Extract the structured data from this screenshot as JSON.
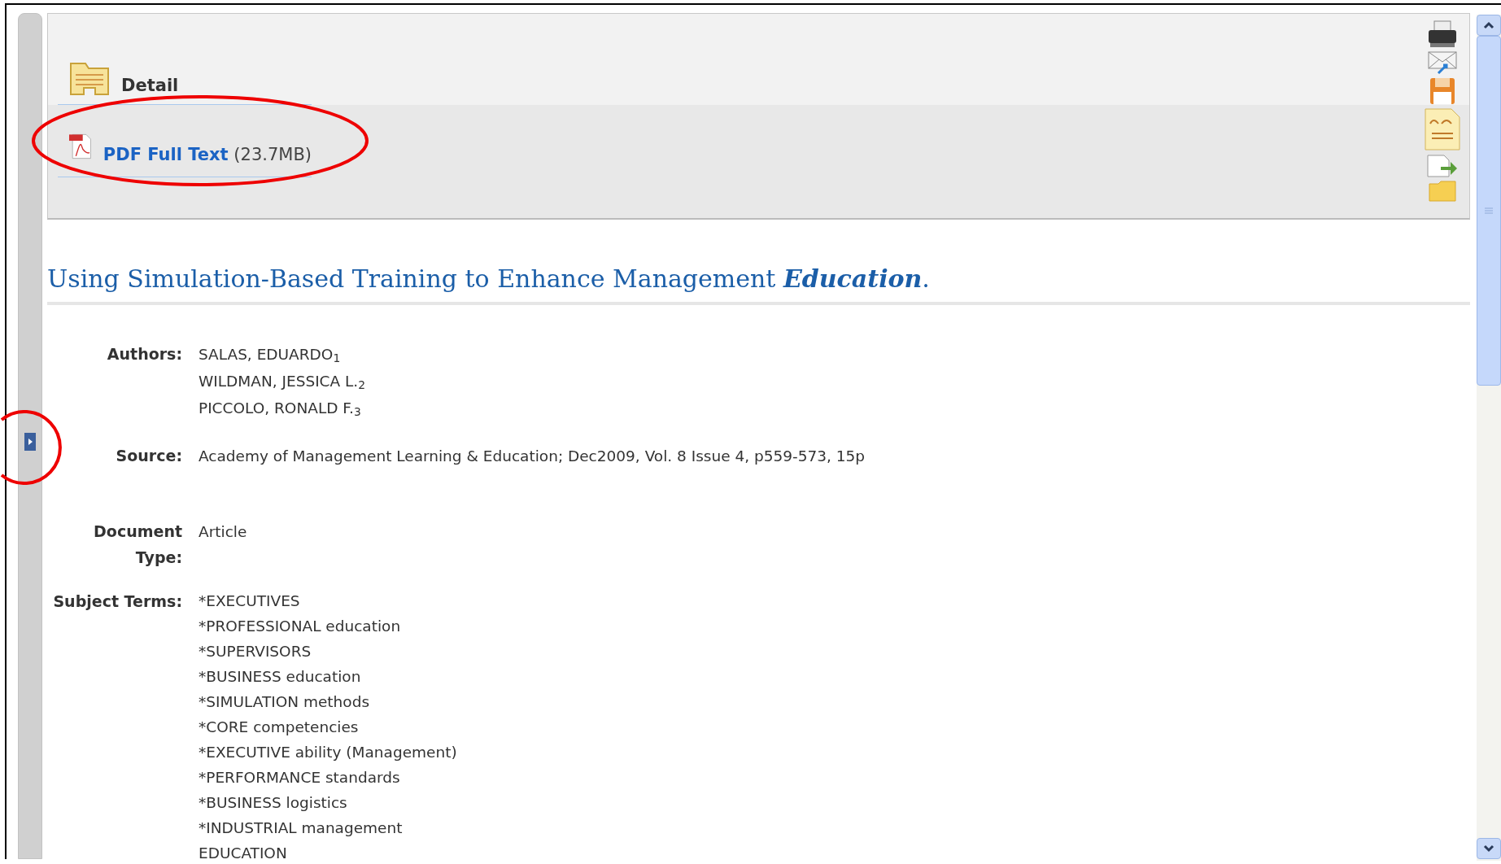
{
  "header": {
    "detail_label": "Detail",
    "pdf_link": "PDF Full Text",
    "pdf_size": "(23.7MB)"
  },
  "title": "Using Simulation-Based Training to Enhance Management **Education**.",
  "fields": [
    {
      "label": "Authors:",
      "values": [
        "SALAS, EDUARDO$_{1}$",
        "WILDMAN, JESSICA L.$_{2}$",
        "PICCOLO, RONALD F.$_{3}$"
      ]
    },
    {
      "label": "Source:",
      "values": [
        "Academy of Management Learning & Education; Dec2009, Vol. 8 Issue 4, p559-573, 15p"
      ]
    },
    {
      "label": "Document Type:",
      "values": [
        "Article"
      ]
    },
    {
      "label": "Subject Terms:",
      "values": [
        "*EXECUTIVES",
        "*PROFESSIONAL education",
        "*SUPERVISORS",
        "*BUSINESS education",
        "*SIMULATION methods",
        "*CORE competencies",
        "*EXECUTIVE ability (Management)",
        "*PERFORMANCE standards",
        "*BUSINESS logistics",
        "*INDUSTRIAL management",
        "EDUCATION"
      ]
    }
  ]
}
